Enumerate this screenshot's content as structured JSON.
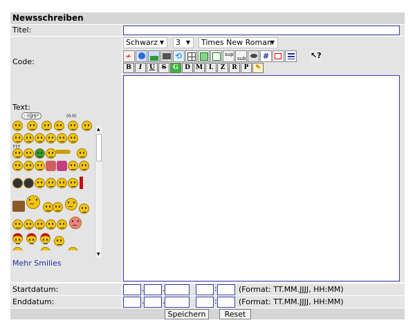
{
  "form": {
    "title": "Newsschreiben",
    "labels": {
      "titel": "Titel:",
      "code": "Code:",
      "text": "Text:",
      "startdatum": "Startdatum:",
      "enddatum": "Enddatum:"
    },
    "titel_value": "",
    "text_value": ""
  },
  "toolbar": {
    "color_select": "Schwarz",
    "size_select": "3",
    "font_select": "Times New Roman",
    "format_buttons": [
      "B",
      "I",
      "U",
      "S",
      "G",
      "D",
      "M",
      "L",
      "Z",
      "R",
      "P"
    ],
    "sup_label": "sup",
    "sub_label": "sub",
    "hash_label": "#"
  },
  "smilies": {
    "more_link": "Mehr Smilies",
    "thought_bubble": ":-)@$*",
    "question_text": "???"
  },
  "dates": {
    "format_hint": "(Format: TT.MM.JJJJ, HH:MM)",
    "date_sep": ".",
    "time_sep": ":"
  },
  "buttons": {
    "save": "Speichern",
    "reset": "Reset"
  }
}
